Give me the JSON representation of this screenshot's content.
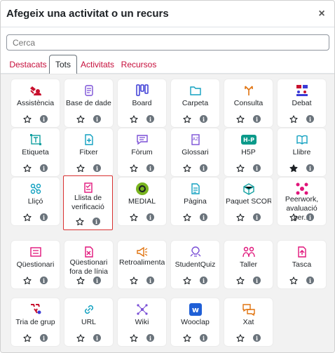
{
  "dialog": {
    "title": "Afegeix una activitat o un recurs",
    "close_symbol": "×"
  },
  "search": {
    "placeholder": "Cerca",
    "value": ""
  },
  "tabs": [
    {
      "label": "Destacats",
      "active": false
    },
    {
      "label": "Tots",
      "active": true
    },
    {
      "label": "Activitats",
      "active": false
    },
    {
      "label": "Recursos",
      "active": false
    }
  ],
  "colors": {
    "accent": "#c60e3b",
    "selection_border": "#d93030",
    "info": "#6a737b"
  },
  "modules": [
    {
      "name": "Assistència",
      "icon": "attendance-icon",
      "starred": false
    },
    {
      "name": "Base de dades",
      "icon": "database-icon",
      "starred": false
    },
    {
      "name": "Board",
      "icon": "board-icon",
      "starred": false
    },
    {
      "name": "Carpeta",
      "icon": "folder-icon",
      "starred": false
    },
    {
      "name": "Consulta",
      "icon": "choice-icon",
      "starred": false
    },
    {
      "name": "Debat",
      "icon": "forum-debate-icon",
      "starred": false
    },
    {
      "name": "Etiqueta",
      "icon": "label-icon",
      "starred": false
    },
    {
      "name": "Fitxer",
      "icon": "file-icon",
      "starred": false
    },
    {
      "name": "Fòrum",
      "icon": "forum-icon",
      "starred": false
    },
    {
      "name": "Glossari",
      "icon": "glossary-icon",
      "starred": false
    },
    {
      "name": "H5P",
      "icon": "h5p-icon",
      "starred": false
    },
    {
      "name": "Llibre",
      "icon": "book-icon",
      "starred": true
    },
    {
      "name": "Lliçó",
      "icon": "lesson-icon",
      "starred": false
    },
    {
      "name": "Llista de verificació",
      "icon": "checklist-icon",
      "starred": false,
      "selected": true
    },
    {
      "name": "MEDIAL",
      "icon": "medial-icon",
      "starred": false
    },
    {
      "name": "Pàgina",
      "icon": "page-icon",
      "starred": false
    },
    {
      "name": "Paquet SCORM",
      "icon": "scorm-icon",
      "starred": false
    },
    {
      "name": "Peerwork, avaluació per...",
      "icon": "peerwork-icon",
      "starred": false
    },
    {
      "name": "Qüestionari",
      "icon": "quiz-icon",
      "starred": false
    },
    {
      "name": "Qüestionari fora de línia",
      "icon": "offline-quiz-icon",
      "starred": false
    },
    {
      "name": "Retroalimentació",
      "icon": "feedback-icon",
      "starred": false
    },
    {
      "name": "StudentQuiz",
      "icon": "studentquiz-icon",
      "starred": false
    },
    {
      "name": "Taller",
      "icon": "workshop-icon",
      "starred": false
    },
    {
      "name": "Tasca",
      "icon": "assignment-icon",
      "starred": false
    },
    {
      "name": "Tria de grup",
      "icon": "group-choice-icon",
      "starred": false
    },
    {
      "name": "URL",
      "icon": "url-icon",
      "starred": false
    },
    {
      "name": "Wiki",
      "icon": "wiki-icon",
      "starred": false
    },
    {
      "name": "Wooclap",
      "icon": "wooclap-icon",
      "starred": false
    },
    {
      "name": "Xat",
      "icon": "chat-icon",
      "starred": false
    }
  ]
}
